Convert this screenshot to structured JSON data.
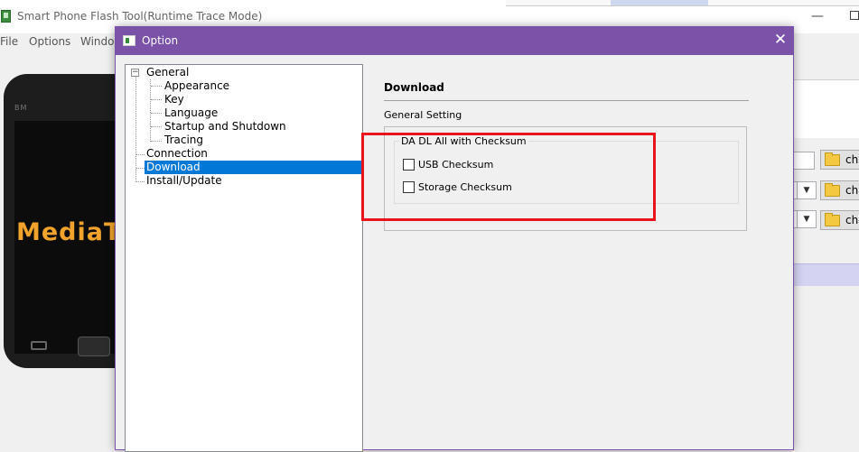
{
  "app": {
    "title": "Smart Phone Flash Tool(Runtime Trace Mode)",
    "menu": [
      "File",
      "Options",
      "Windo"
    ]
  },
  "phone": {
    "brand": "BM",
    "logo_text": "MediaTek"
  },
  "background_panel": {
    "choose_label": "cho"
  },
  "dialog": {
    "title": "Option",
    "tree": {
      "root": "General",
      "children": [
        "Appearance",
        "Key",
        "Language",
        "Startup and Shutdown",
        "Tracing"
      ],
      "items": [
        "Connection",
        "Download",
        "Install/Update"
      ],
      "selected": "Download"
    },
    "section_title": "Download",
    "sub_label": "General Setting",
    "group_title": "DA DL All with Checksum",
    "checkboxes": [
      {
        "label": "USB Checksum",
        "checked": false
      },
      {
        "label": "Storage Checksum",
        "checked": false
      }
    ]
  },
  "colors": {
    "dialog_titlebar": "#7a52a8",
    "selection": "#0078d7",
    "highlight_box": "#e8141c"
  }
}
